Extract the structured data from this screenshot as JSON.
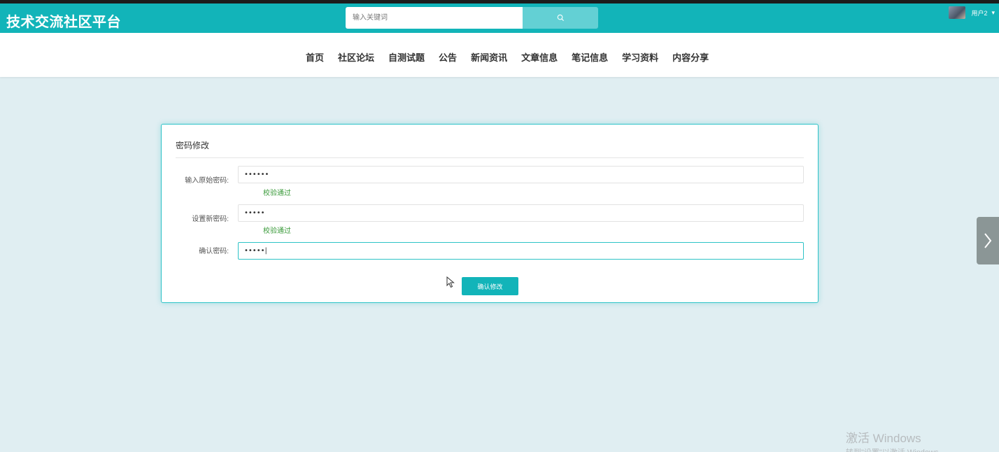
{
  "header": {
    "brand": "技术交流社区平台",
    "search_placeholder": "输入关键词",
    "user_name": "用户2",
    "user_caret": "▾",
    "accent_color": "#12b4b9"
  },
  "nav": {
    "items": [
      "首页",
      "社区论坛",
      "自测试题",
      "公告",
      "新闻资讯",
      "文章信息",
      "笔记信息",
      "学习资料",
      "内容分享"
    ]
  },
  "form": {
    "title": "密码修改",
    "fields": [
      {
        "label": "输入原始密码:",
        "value": "••••••",
        "hint": "校验通过"
      },
      {
        "label": "设置新密码:",
        "value": "•••••",
        "hint": "校验通过"
      },
      {
        "label": "确认密码:",
        "value": "•••••|",
        "hint": ""
      }
    ],
    "submit_label": "确认修改"
  },
  "watermark": {
    "title": "激活 Windows",
    "subtitle": "转到\"设置\"以激活 Windows。"
  },
  "icons": {
    "search": "search-icon",
    "side_arrow": "chevron-right-icon",
    "cursor": "mouse-pointer-icon"
  }
}
